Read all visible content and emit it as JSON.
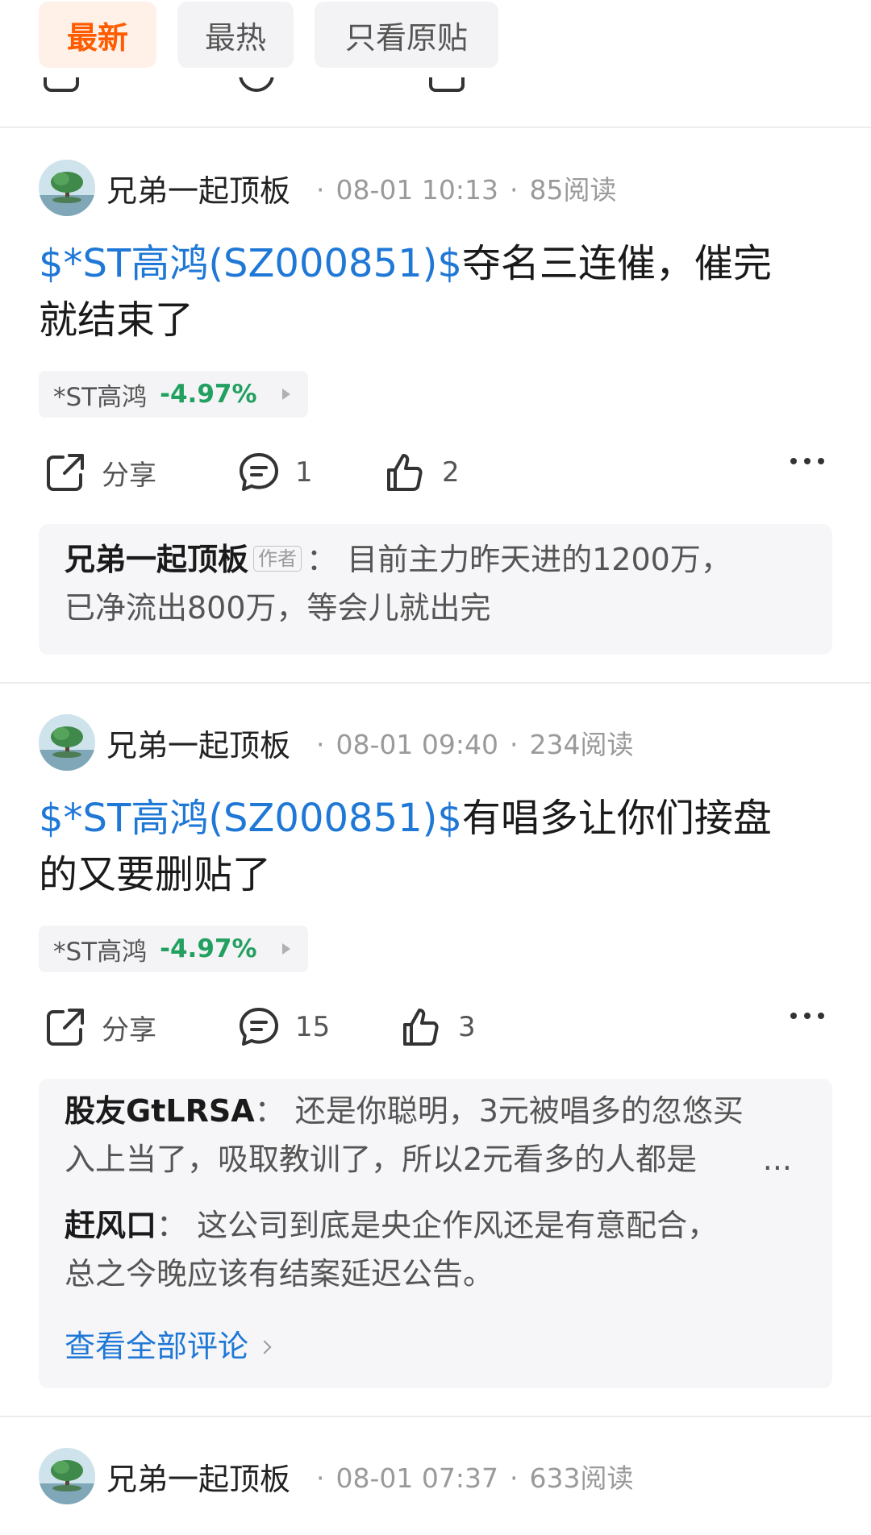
{
  "tabs": [
    {
      "label": "最新",
      "active": true
    },
    {
      "label": "最热",
      "active": false
    },
    {
      "label": "只看原贴",
      "active": false
    }
  ],
  "action_labels": {
    "share": "分享"
  },
  "colors": {
    "accent": "#ff5c00",
    "link": "#1f78d6",
    "down": "#22a060"
  },
  "posts": [
    {
      "author": "兄弟一起顶板",
      "time": "08-01 10:13",
      "reads": "85阅读",
      "stock_link": "$*ST高鸿(SZ000851)$",
      "text_line1": "夺名三连催，催完",
      "text_line2": "就结束了",
      "stock_name": "*ST高鸿",
      "stock_change": "-4.97%",
      "comments": "1",
      "likes": "2",
      "replies": [
        {
          "user": "兄弟一起顶板",
          "tag": "作者",
          "line1": "目前主力昨天进的1200万，",
          "line2": "已净流出800万，等会儿就出完"
        }
      ]
    },
    {
      "author": "兄弟一起顶板",
      "time": "08-01 09:40",
      "reads": "234阅读",
      "stock_link": "$*ST高鸿(SZ000851)$",
      "text_line1": "有唱多让你们接盘",
      "text_line2": "的又要删贴了",
      "stock_name": "*ST高鸿",
      "stock_change": "-4.97%",
      "comments": "15",
      "likes": "3",
      "replies": [
        {
          "user": "股友GtLRSA",
          "line1": "还是你聪明，3元被唱多的忽悠买",
          "line2": "入上当了，吸取教训了，所以2元看多的人都是",
          "ellipsis": "..."
        },
        {
          "user": "赶风口",
          "line1": "这公司到底是央企作风还是有意配合，",
          "line2": "总之今晚应该有结案延迟公告。"
        }
      ],
      "view_all": "查看全部评论"
    },
    {
      "author": "兄弟一起顶板",
      "time": "08-01 07:37",
      "reads": "633阅读"
    }
  ]
}
